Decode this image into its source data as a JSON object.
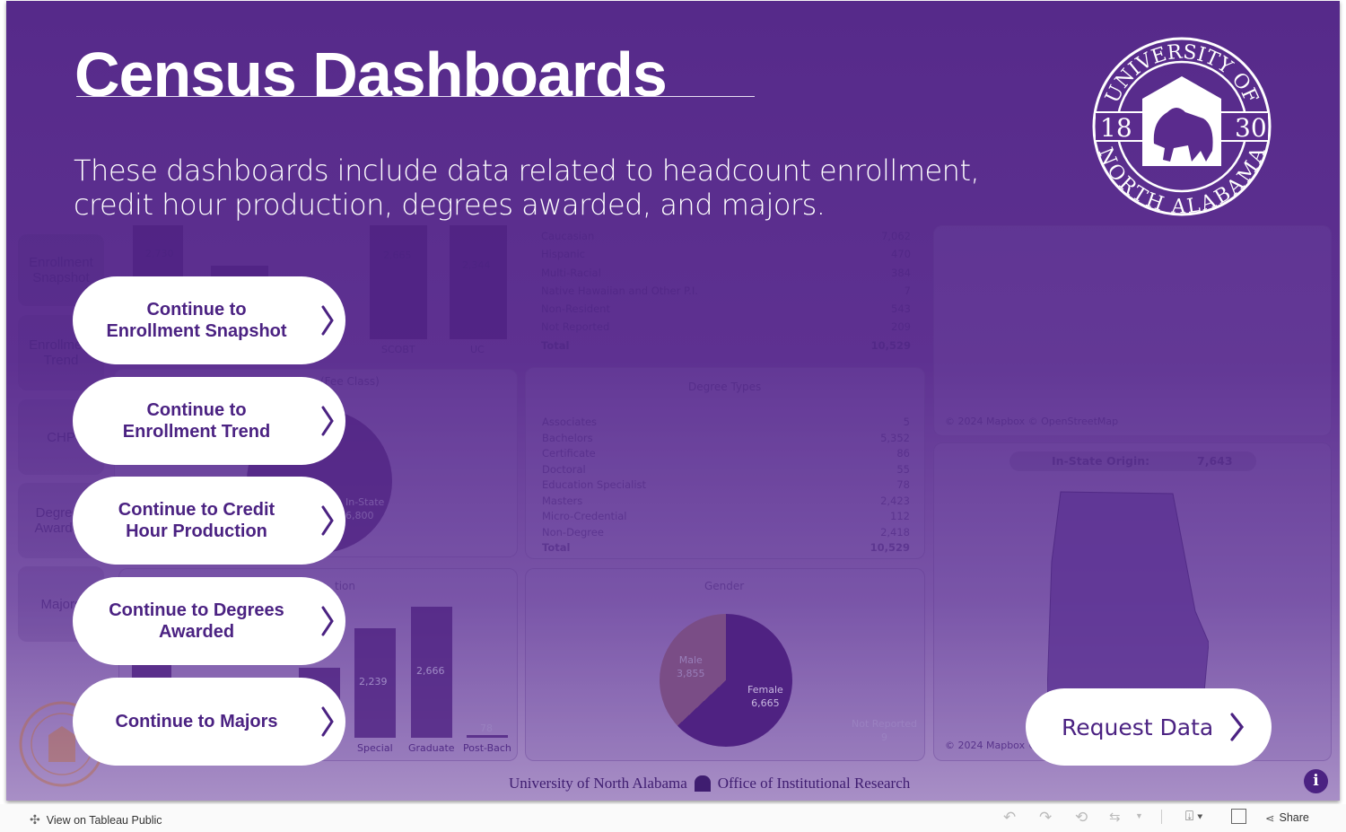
{
  "header": {
    "title": "Census Dashboards",
    "subtitle_line1": "These dashboards include data related to headcount enrollment,",
    "subtitle_line2": "credit hour production, degrees awarded, and majors."
  },
  "logo": {
    "text": "UNIVERSITY OF NORTH ALABAMA",
    "year_left": "18",
    "year_right": "30"
  },
  "nav_buttons": [
    {
      "line1": "Continue to",
      "line2": "Enrollment Snapshot"
    },
    {
      "line1": "Continue to",
      "line2": "Enrollment Trend"
    },
    {
      "line1": "Continue to Credit",
      "line2": "Hour Production"
    },
    {
      "line1": "Continue to Degrees",
      "line2": "Awarded"
    },
    {
      "line1": "Continue to Majors",
      "line2": ""
    }
  ],
  "request_button": "Request Data",
  "background": {
    "tiles": [
      "Enrollment Snapshot",
      "Enrollment Trend",
      "CHP",
      "Degrees Awarded",
      "Majors"
    ],
    "college_bars": [
      {
        "label": "",
        "value": "2,730"
      },
      {
        "label": "SCOBT",
        "value": "2,665"
      },
      {
        "label": "UC",
        "value": "2,344"
      }
    ],
    "fee_class_title": "(Fee Class)",
    "fee_class_label": "In-State",
    "fee_class_value": "6,800",
    "ethnicity": [
      {
        "k": "Caucasian",
        "v": "7,062"
      },
      {
        "k": "Hispanic",
        "v": "470"
      },
      {
        "k": "Multi-Racial",
        "v": "384"
      },
      {
        "k": "Native Hawaiian and Other P.I.",
        "v": "7"
      },
      {
        "k": "Non-Resident",
        "v": "543"
      },
      {
        "k": "Not Reported",
        "v": "209"
      },
      {
        "k": "Total",
        "v": "10,529"
      }
    ],
    "degree_title": "Degree Types",
    "degrees": [
      {
        "k": "Associates",
        "v": "5"
      },
      {
        "k": "Bachelors",
        "v": "5,352"
      },
      {
        "k": "Certificate",
        "v": "86"
      },
      {
        "k": "Doctoral",
        "v": "55"
      },
      {
        "k": "Education Specialist",
        "v": "78"
      },
      {
        "k": "Masters",
        "v": "2,423"
      },
      {
        "k": "Micro-Credential",
        "v": "112"
      },
      {
        "k": "Non-Degree",
        "v": "2,418"
      },
      {
        "k": "Total",
        "v": "10,529"
      }
    ],
    "class_title": "tion",
    "class_bars": [
      {
        "label": "Special",
        "value": "2,239"
      },
      {
        "label": "Graduate",
        "value": "2,666"
      },
      {
        "label": "Post-Bach",
        "value": "78"
      }
    ],
    "gender_title": "Gender",
    "male_label": "Male",
    "male_value": "3,855",
    "female_label": "Female",
    "female_value": "6,665",
    "nr_label": "Not Reported",
    "nr_value": "9",
    "map_credit": "© 2024 Mapbox © OpenStreetMap",
    "map_credit2": "© 2024 Mapbox ©",
    "instate_label": "In-State Origin:",
    "instate_value": "7,643"
  },
  "footer": {
    "university": "University of North Alabama",
    "office": "Office of Institutional Research"
  },
  "toolbar": {
    "view_label": "View on Tableau Public",
    "share_label": "Share"
  },
  "colors": {
    "brand_purple": "#4b2282",
    "background": "#5e3191",
    "button": "#ffffff"
  }
}
